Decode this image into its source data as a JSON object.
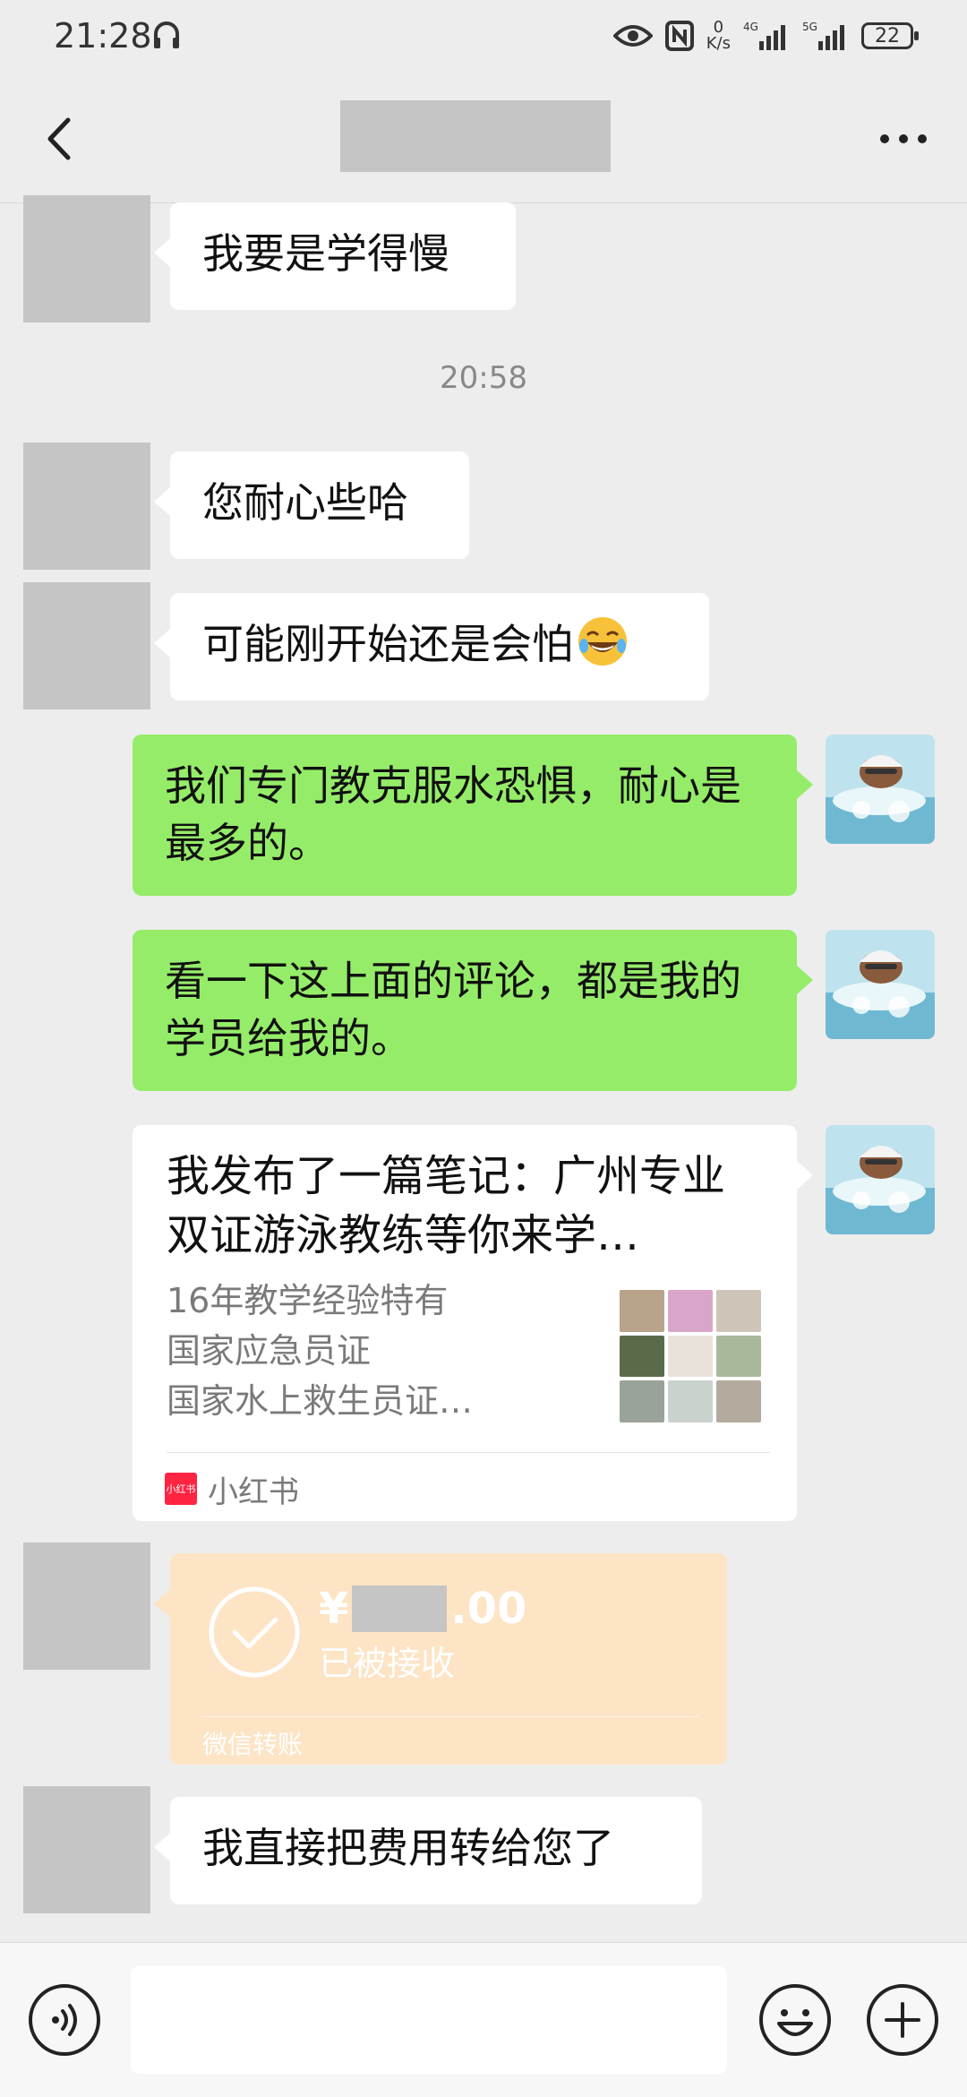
{
  "status_bar": {
    "time": "21:28",
    "net_speed_value": "0",
    "net_speed_unit": "K/s",
    "battery": "22",
    "network_labels": [
      "4G",
      "5G"
    ]
  },
  "nav": {
    "back_icon": "chevron-left-icon",
    "title_redacted": true,
    "more_icon": "more-dots-icon"
  },
  "messages": [
    {
      "side": "left",
      "type": "text",
      "text": "我要是学得慢"
    },
    {
      "type": "timestamp",
      "text": "20:58"
    },
    {
      "side": "left",
      "type": "text",
      "text": "您耐心些哈"
    },
    {
      "side": "left",
      "type": "text",
      "text": "可能刚开始还是会怕",
      "emoji": "laughing-tears"
    },
    {
      "side": "right",
      "type": "text",
      "text": "我们专门教克服水恐惧，耐心是最多的。"
    },
    {
      "side": "right",
      "type": "text",
      "text": "看一下这上面的评论，都是我的学员给我的。"
    },
    {
      "side": "right",
      "type": "link_card",
      "title": "我发布了一篇笔记：广州专业双证游泳教练等你来学…",
      "desc_line1": "16年教学经验特有",
      "desc_line2": "国家应急员证",
      "desc_line3": "国家水上救生员证…",
      "source_icon_text": "小红书",
      "source": "小红书"
    },
    {
      "side": "left",
      "type": "transfer",
      "currency": "¥",
      "amount_suffix": ".00",
      "status": "已被接收",
      "footer": "微信转账"
    },
    {
      "side": "left",
      "type": "text",
      "text": "我直接把费用转给您了"
    }
  ],
  "input_bar": {
    "voice_icon": "voice-icon",
    "input_value": "",
    "emoji_icon": "emoji-icon",
    "plus_icon": "plus-icon"
  },
  "colors": {
    "background": "#ededed",
    "sent_bubble": "#95ec69",
    "received_bubble": "#ffffff",
    "transfer_bubble": "#fde4c5",
    "xiaohongshu_red": "#ff2442"
  }
}
